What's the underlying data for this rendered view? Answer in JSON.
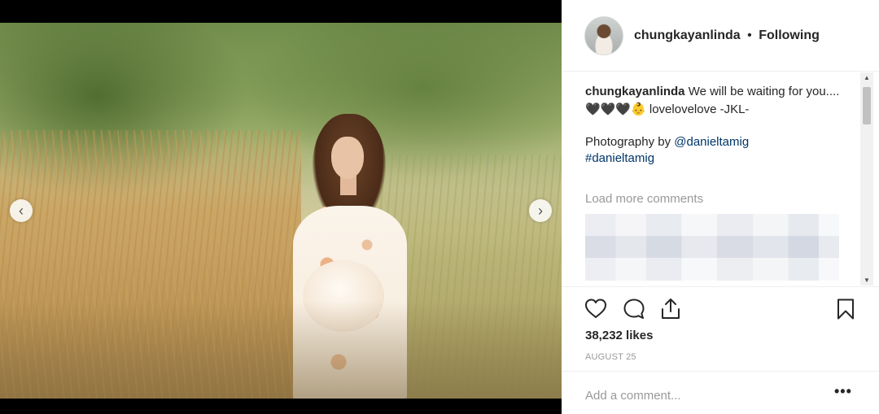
{
  "post": {
    "username": "chungkayanlinda",
    "separator": "•",
    "follow_status": "Following"
  },
  "caption": {
    "username": "chungkayanlinda",
    "text": "We will be waiting for you....",
    "line2": "🖤🖤🖤👶 lovelovelove -JKL-",
    "photo_credit_prefix": "Photography by",
    "photo_credit_mention": "@danieltamig",
    "hashtag": "#danieltamig"
  },
  "load_more": "Load more comments",
  "likes": "38,232 likes",
  "date": "AUGUST 25",
  "comment_box": {
    "placeholder": "Add a comment..."
  },
  "more_options": "•••",
  "carousel": {
    "prev": "‹",
    "next": "›"
  },
  "scrollbar": {
    "up": "▲",
    "down": "▼"
  },
  "icons": {
    "like": "heart-icon",
    "comment": "comment-bubble-icon",
    "share": "share-upload-icon",
    "save": "bookmark-icon"
  },
  "colors": {
    "text": "#262626",
    "muted": "#999999",
    "mention": "#003569",
    "border": "#efefef"
  }
}
